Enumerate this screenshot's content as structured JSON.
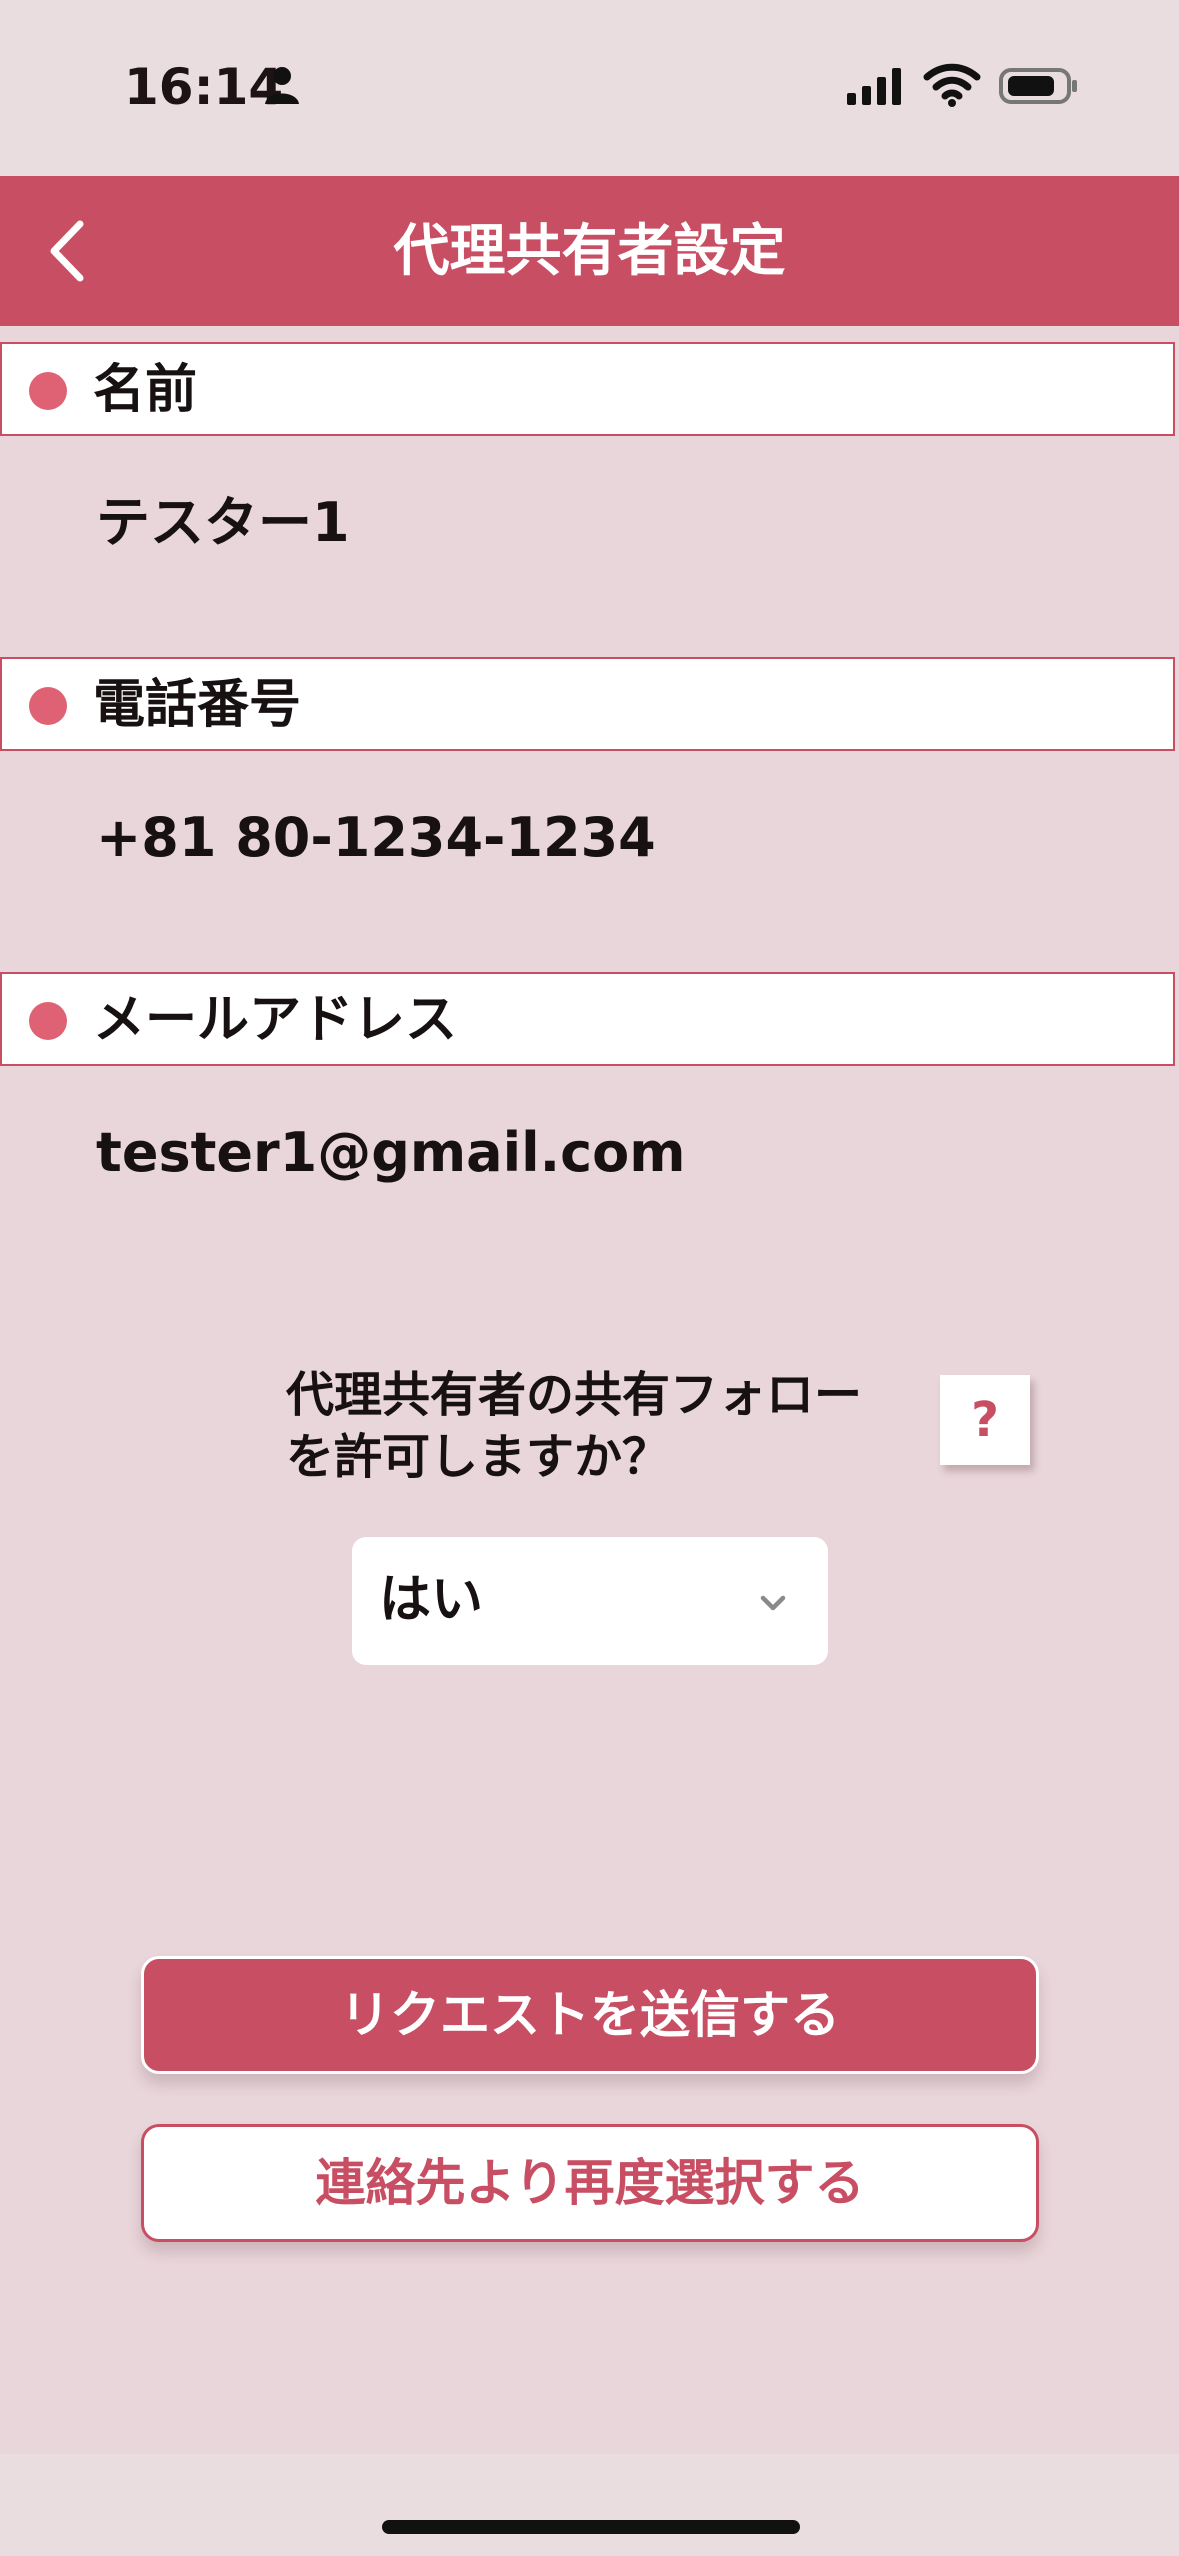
{
  "status_bar": {
    "time": "16:14",
    "icons": [
      "person-icon",
      "cellular-signal-icon",
      "wifi-icon",
      "battery-icon"
    ]
  },
  "navigation": {
    "title": "代理共有者設定",
    "back_icon": "chevron-left-icon"
  },
  "sections": [
    {
      "label": "名前",
      "value": "テスター1"
    },
    {
      "label": "電話番号",
      "value": "+81 80-1234-1234"
    },
    {
      "label": "メールアドレス",
      "value": "tester1@gmail.com"
    }
  ],
  "sharing_permission": {
    "question_line_1": "代理共有者の共有フォロー",
    "question_line_2": "を許可しますか？",
    "help_label": "?",
    "selected_value": "はい",
    "dropdown_icon": "chevron-down-icon"
  },
  "actions": {
    "send_request_label": "リクエストを送信する",
    "reselect_contact_label": "連絡先より再度選択する"
  },
  "colors": {
    "background": "#e9d6da",
    "accent": "#c84f63",
    "section_dot": "#df6274",
    "surface": "#ffffff",
    "text": "#171112"
  }
}
